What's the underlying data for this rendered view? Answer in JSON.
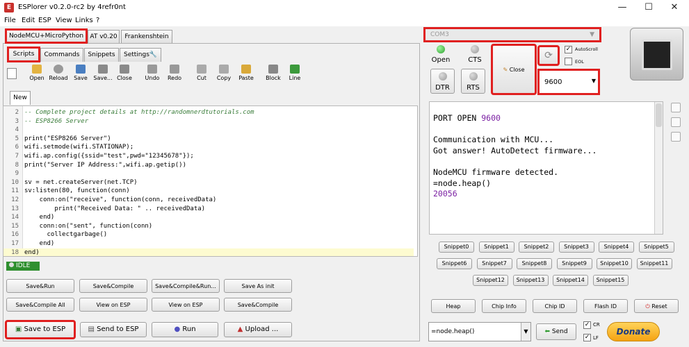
{
  "window": {
    "title": "ESPlorer v0.2.0-rc2 by 4refr0nt",
    "minimize": "—",
    "maximize": "☐",
    "close": "✕"
  },
  "menu": [
    "File",
    "Edit",
    "ESP",
    "View",
    "Links",
    "?"
  ],
  "firmware_tabs": [
    "NodeMCU+MicroPython",
    "AT v0.20",
    "Frankenshtein"
  ],
  "sub_tabs": [
    "Scripts",
    "Commands",
    "Snippets",
    "Settings"
  ],
  "toolbar": [
    "Open",
    "Reload",
    "Save",
    "Save...",
    "Close",
    "Undo",
    "Redo",
    "Cut",
    "Copy",
    "Paste",
    "Block",
    "Line"
  ],
  "file_tab": "New",
  "code": [
    {
      "n": "2",
      "t": "-- Complete project details at http://randomnerdtutorials.com"
    },
    {
      "n": "3",
      "t": "-- ESP8266 Server"
    },
    {
      "n": "4",
      "t": ""
    },
    {
      "n": "5",
      "t": "print(\"ESP8266 Server\")"
    },
    {
      "n": "6",
      "t": "wifi.setmode(wifi.STATIONAP);"
    },
    {
      "n": "7",
      "t": "wifi.ap.config({ssid=\"test\",pwd=\"12345678\"});"
    },
    {
      "n": "8",
      "t": "print(\"Server IP Address:\",wifi.ap.getip())"
    },
    {
      "n": "9",
      "t": ""
    },
    {
      "n": "10",
      "t": "sv = net.createServer(net.TCP)"
    },
    {
      "n": "11",
      "t": "sv:listen(80, function(conn)"
    },
    {
      "n": "12",
      "t": "    conn:on(\"receive\", function(conn, receivedData)"
    },
    {
      "n": "13",
      "t": "        print(\"Received Data: \" .. receivedData)"
    },
    {
      "n": "14",
      "t": "    end)"
    },
    {
      "n": "15",
      "t": "    conn:on(\"sent\", function(conn)"
    },
    {
      "n": "16",
      "t": "      collectgarbage()"
    },
    {
      "n": "17",
      "t": "    end)"
    },
    {
      "n": "18",
      "t": "end)"
    }
  ],
  "status": "IDLE",
  "action_rows": [
    [
      "Save&Run",
      "Save&Compile",
      "Save&Compile&Run...",
      "Save As init"
    ],
    [
      "Save&Compile All",
      "View on ESP",
      "View on ESP",
      "Save&Compile"
    ]
  ],
  "bottom_buttons": {
    "save": "Save to ESP",
    "send": "Send to ESP",
    "run": "Run",
    "upload": "Upload ..."
  },
  "port": "COM3",
  "leds": {
    "open": "Open",
    "cts": "CTS"
  },
  "buttons": {
    "dtr": "DTR",
    "rts": "RTS",
    "close": "Close",
    "send": "Send",
    "donate": "Donate"
  },
  "checks": {
    "autoscroll": "AutoScroll",
    "eol": "EOL",
    "cr": "CR",
    "lf": "LF"
  },
  "baud": "9600",
  "terminal": [
    {
      "t": "PORT OPEN ",
      "v": "9600"
    },
    {
      "t": ""
    },
    {
      "t": "Communication with MCU..."
    },
    {
      "t": "Got answer! AutoDetect firmware..."
    },
    {
      "t": ""
    },
    {
      "t": "NodeMCU firmware detected."
    },
    {
      "t": "=node.heap()"
    },
    {
      "v": "20056"
    }
  ],
  "snippets": [
    [
      "Snippet0",
      "Snippet1",
      "Snippet2",
      "Snippet3",
      "Snippet4",
      "Snippet5"
    ],
    [
      "Snippet6",
      "Snippet7",
      "Snippet8",
      "Snippet9",
      "Snippet10",
      "Snippet11"
    ],
    [
      "Snippet12",
      "Snippet13",
      "Snippet14",
      "Snippet15"
    ]
  ],
  "esp_buttons": [
    "Heap",
    "Chip Info",
    "Chip ID",
    "Flash ID",
    "Reset"
  ],
  "command_value": "=node.heap()",
  "colors": {
    "accent_red": "#e02020",
    "purple": "#7a1fa2"
  }
}
